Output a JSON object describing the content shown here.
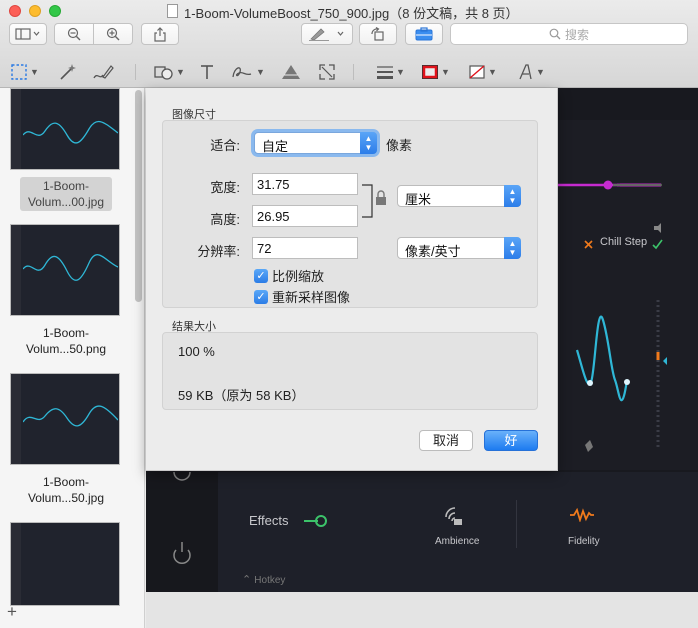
{
  "window": {
    "title": "1-Boom-VolumeBoost_750_900.jpg（8 份文稿，共 8 页）"
  },
  "toolbar": {
    "search_placeholder": "搜索"
  },
  "sidebar": {
    "items": [
      {
        "label": "1-Boom-Volum...00.jpg",
        "selected": true
      },
      {
        "label": "1-Boom-\nVolum...50.png"
      },
      {
        "label": "1-Boom-\nVolum...50.jpg"
      },
      {
        "label": ""
      }
    ]
  },
  "background_doc": {
    "chill_step": "Chill Step",
    "effects": "Effects",
    "ambience": "Ambience",
    "fidelity": "Fidelity",
    "hotkey": "Hotkey",
    "accent": "#c62bd0",
    "teal": "#2fb7d6",
    "green": "#3cc36a",
    "orange": "#f07a1c"
  },
  "dialog": {
    "image_size_title": "图像尺寸",
    "fit_label": "适合:",
    "fit_value": "自定",
    "fit_unit": "像素",
    "width_label": "宽度:",
    "width_value": "31.75",
    "height_label": "高度:",
    "height_value": "26.95",
    "unit_value": "厘米",
    "resolution_label": "分辨率:",
    "resolution_value": "72",
    "resolution_unit": "像素/英寸",
    "scale_proportionally": "比例缩放",
    "resample": "重新采样图像",
    "result_title": "结果大小",
    "result_percent": "100 %",
    "result_size": "59 KB（原为 58 KB）",
    "cancel": "取消",
    "ok": "好",
    "accent": "#1d7bf0"
  }
}
